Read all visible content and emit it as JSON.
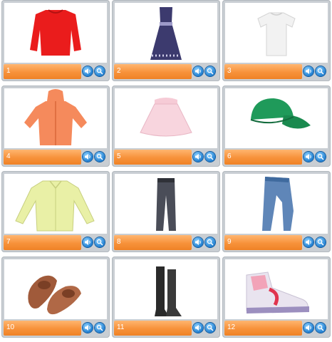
{
  "items": [
    {
      "number": "1",
      "item": "sweater"
    },
    {
      "number": "2",
      "item": "dress"
    },
    {
      "number": "3",
      "item": "t-shirt"
    },
    {
      "number": "4",
      "item": "hooded-jacket"
    },
    {
      "number": "5",
      "item": "skirt"
    },
    {
      "number": "6",
      "item": "cap"
    },
    {
      "number": "7",
      "item": "shirt"
    },
    {
      "number": "8",
      "item": "trousers"
    },
    {
      "number": "9",
      "item": "jeans"
    },
    {
      "number": "10",
      "item": "moccasins"
    },
    {
      "number": "11",
      "item": "boots"
    },
    {
      "number": "12",
      "item": "sneakers"
    }
  ],
  "icons": {
    "sound": "speaker-icon",
    "zoom": "magnifier-icon"
  },
  "colors": {
    "label_bar": "#f7923a",
    "button": "#1f7fd1",
    "card": "#c9ced3"
  }
}
